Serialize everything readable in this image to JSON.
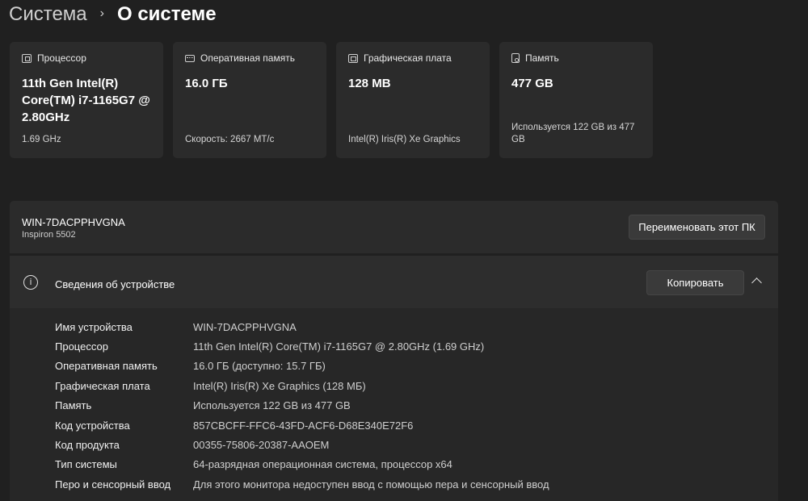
{
  "breadcrumb": {
    "parent": "Система",
    "separator": "›",
    "current": "О системе"
  },
  "cards": [
    {
      "icon": "cpu-icon",
      "title": "Процессор",
      "value": "11th Gen Intel(R) Core(TM) i7-1165G7 @ 2.80GHz",
      "sub": "1.69 GHz"
    },
    {
      "icon": "ram-icon",
      "title": "Оперативная память",
      "value": "16.0 ГБ",
      "sub": "Скорость: 2667 МТ/с"
    },
    {
      "icon": "gpu-icon",
      "title": "Графическая плата",
      "value": "128 MB",
      "sub": "Intel(R) Iris(R) Xe Graphics"
    },
    {
      "icon": "storage-icon",
      "title": "Память",
      "value": "477 GB",
      "sub": "Используется 122 GB из 477 GB"
    }
  ],
  "pc": {
    "name": "WIN-7DACPPHVGNA",
    "model": "Inspiron 5502",
    "rename_label": "Переименовать этот ПК"
  },
  "device_info": {
    "title": "Сведения об устройстве",
    "copy_label": "Копировать",
    "rows": [
      {
        "label": "Имя устройства",
        "value": "WIN-7DACPPHVGNA"
      },
      {
        "label": "Процессор",
        "value": "11th Gen Intel(R) Core(TM) i7-1165G7 @ 2.80GHz (1.69 GHz)"
      },
      {
        "label": "Оперативная память",
        "value": "16.0 ГБ (доступно: 15.7 ГБ)"
      },
      {
        "label": "Графическая плата",
        "value": "Intel(R) Iris(R) Xe Graphics (128 МБ)"
      },
      {
        "label": "Память",
        "value": "Используется 122 GB из 477 GB"
      },
      {
        "label": "Код устройства",
        "value": "857CBCFF-FFC6-43FD-ACF6-D68E340E72F6"
      },
      {
        "label": "Код продукта",
        "value": "00355-75806-20387-AAOEM"
      },
      {
        "label": "Тип системы",
        "value": "64-разрядная операционная система, процессор x64"
      },
      {
        "label": "Перо и сенсорный ввод",
        "value": "Для этого монитора недоступен ввод с помощью пера и сенсорный ввод"
      }
    ]
  },
  "colors": {
    "background": "#202020",
    "card": "#2b2b2b",
    "button": "#3a3a3a"
  }
}
